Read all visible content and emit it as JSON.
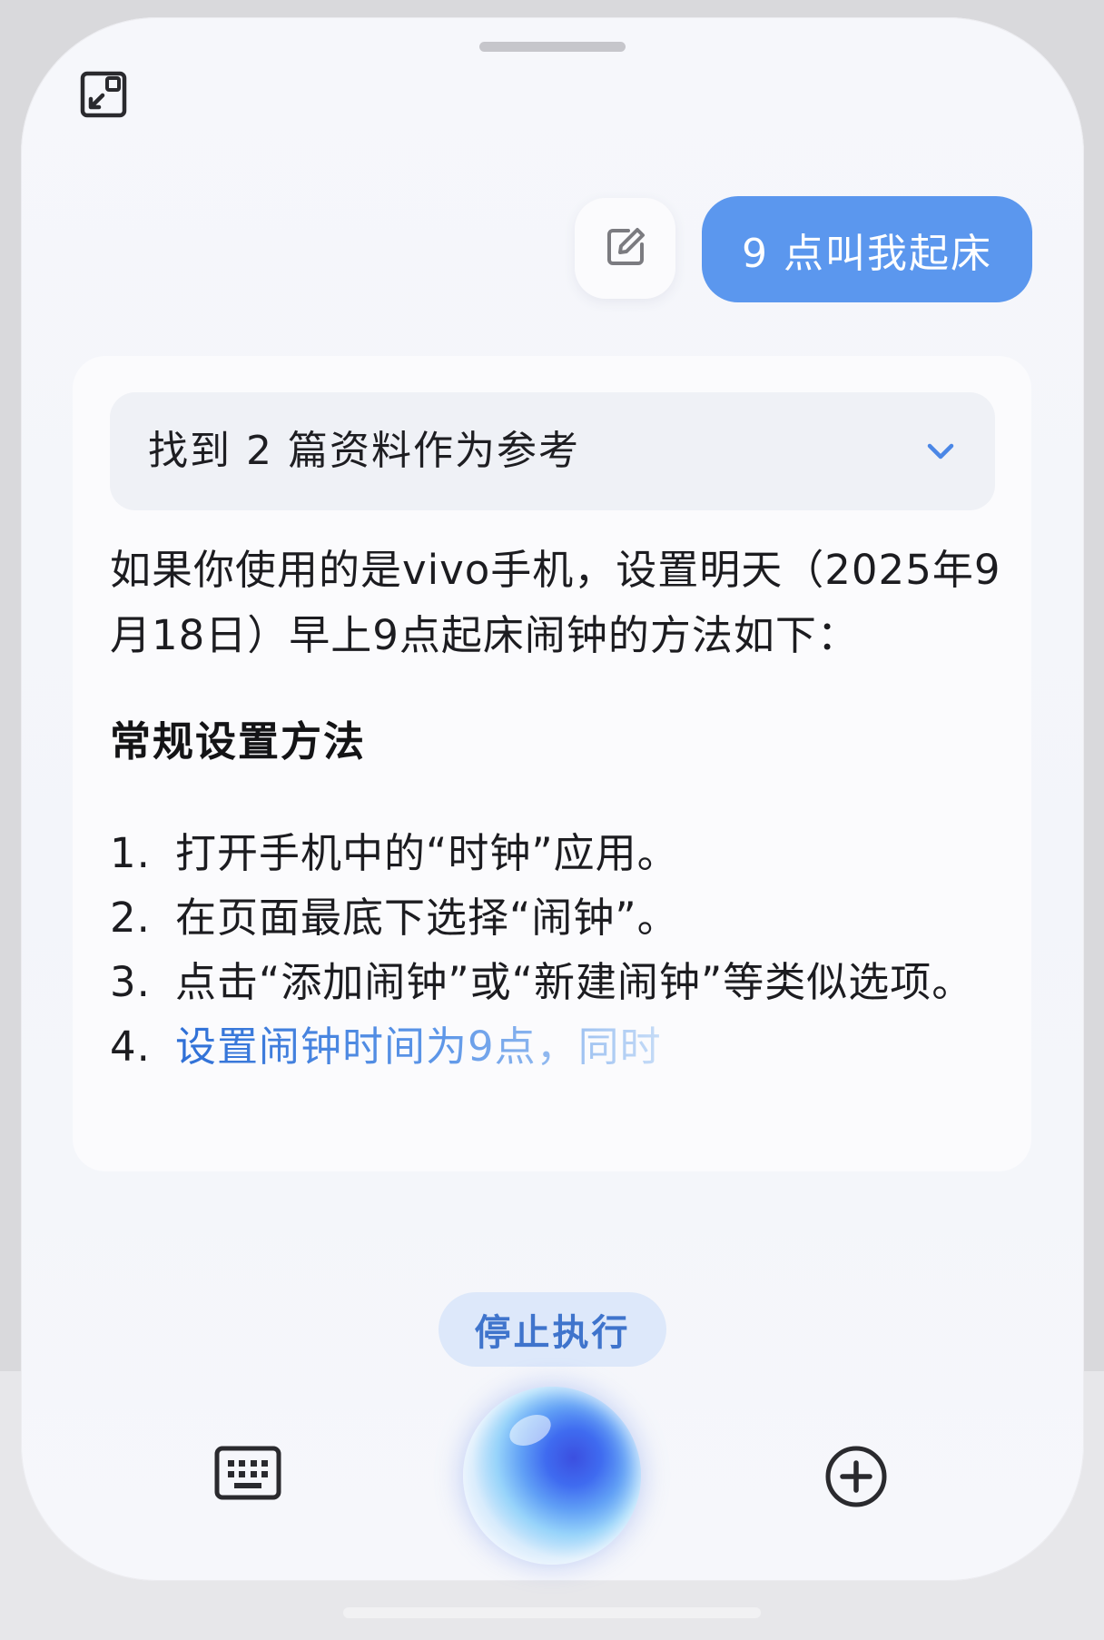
{
  "user_message": "9 点叫我起床",
  "references": {
    "label": "找到 2 篇资料作为参考"
  },
  "answer": {
    "intro": "如果你使用的是vivo手机，设置明天（2025年9月18日）早上9点起床闹钟的方法如下：",
    "heading": "常规设置方法",
    "steps": [
      {
        "num": "1.",
        "text": "打开手机中的“时钟”应用。"
      },
      {
        "num": "2.",
        "text": "在页面最底下选择“闹钟”。"
      },
      {
        "num": "3.",
        "text": "点击“添加闹钟”或“新建闹钟”等类似选项。"
      },
      {
        "num": "4.",
        "text": "设置闹钟时间为9点，同时"
      }
    ]
  },
  "stop_button": {
    "label": "停止执行"
  },
  "icons": {
    "floating_window": "floating-window-icon",
    "edit": "edit-icon",
    "chevron": "chevron-down-icon",
    "keyboard": "keyboard-icon",
    "assistant": "assistant-orb-icon",
    "add": "add-circle-icon"
  },
  "colors": {
    "accent": "#5b97ee",
    "stop_button_bg": "#dde8fa",
    "stop_button_text": "#3f74cc"
  }
}
